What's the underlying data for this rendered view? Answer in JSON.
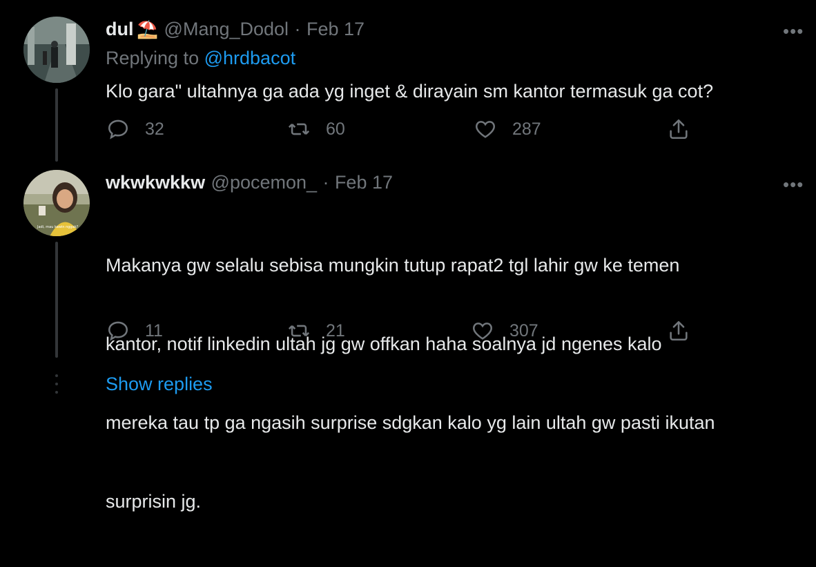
{
  "tweets": [
    {
      "display_name": "dul",
      "name_emoji": "⛱️",
      "handle": "@Mang_Dodol",
      "separator": "·",
      "date": "Feb 17",
      "replying_prefix": "Replying to",
      "replying_handle": "@hrdbacot",
      "text": "Klo gara\" ultahnya ga ada yg inget & dirayain sm kantor termasuk ga cot?",
      "replies": "32",
      "retweets": "60",
      "likes": "287"
    },
    {
      "display_name": "wkwkwkkw",
      "handle": "@pocemon_",
      "separator": "·",
      "date": "Feb 17",
      "text_lines": [
        "Makanya gw selalu sebisa mungkin tutup rapat2 tgl lahir gw ke temen",
        "kantor, notif linkedin ultah jg gw offkan haha soalnya jd ngenes kalo",
        "mereka tau tp ga ngasih surprise sdgkan kalo yg lain ultah gw pasti ikutan",
        "surprisin jg."
      ],
      "avatar_caption": "Jadi, mau kawin nggak?",
      "replies": "11",
      "retweets": "21",
      "likes": "307"
    }
  ],
  "more_glyph": "•••",
  "show_replies": "Show replies",
  "colors": {
    "background": "#000000",
    "text": "#e7e9ea",
    "muted": "#71767b",
    "accent": "#1d9bf0"
  }
}
